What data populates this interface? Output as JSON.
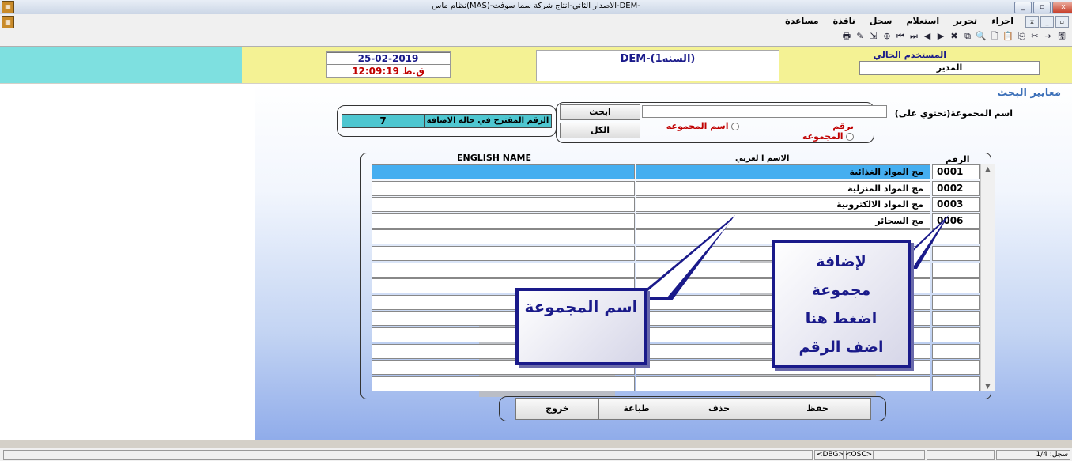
{
  "window": {
    "title": "نظام ماس(MAS)-الاصدار الثاني-انتاج شركة سما سوفت-DEM-",
    "controls": [
      "_",
      "▫",
      "x"
    ]
  },
  "menubar": {
    "items": [
      "اجراء",
      "تحرير",
      "استعلام",
      "سجل",
      "نافذة",
      "مساعدة"
    ],
    "mdi_controls": [
      "x",
      "_",
      "▫"
    ]
  },
  "toolbar": {
    "icons": [
      "save-icon",
      "exit-icon",
      "cut-icon",
      "copy-icon",
      "paste-icon",
      "new-icon",
      "query-icon",
      "duplicate-icon",
      "delete-icon",
      "next-icon",
      "prev-icon",
      "last-icon",
      "first-icon",
      "insert-icon",
      "export-icon",
      "find-icon",
      "print-icon"
    ],
    "glyphs": [
      "🖫",
      "⇥",
      "✂",
      "⎘",
      "📋",
      "🗋",
      "🔍",
      "⧉",
      "✖",
      "▶",
      "◀",
      "⏭",
      "⏮",
      "⊕",
      "⇲",
      "✎",
      "🖶"
    ]
  },
  "header": {
    "date": "25-02-2019",
    "time": "12:09:19 ق.ظ",
    "company": "DEM-(السنه1)",
    "current_user_label": "المستخدم الحالي",
    "current_user": "المدير"
  },
  "search": {
    "page_title": "معايير البحث",
    "group_name_label": "اسم المجموعة(تحتوي على)",
    "group_name_value": "",
    "search_button": "ابحث",
    "all_button": "الكل",
    "radio_by_number": "برقم المجموعه",
    "radio_by_name": "اسم المجموعه",
    "suggested_label": "الرقم المقترح في حالة الاضافة",
    "suggested_value": "7"
  },
  "grid": {
    "columns": {
      "number": "الرقم",
      "arabic": "الاسم ا لعربي",
      "english": "ENGLISH NAME"
    },
    "rows": [
      {
        "number": "0001",
        "arabic": "مج المواد الغذائية",
        "english": "",
        "selected": true
      },
      {
        "number": "0002",
        "arabic": "مج المواد المنزلية",
        "english": "",
        "selected": false
      },
      {
        "number": "0003",
        "arabic": "مج المواد الالكترونية",
        "english": "",
        "selected": false
      },
      {
        "number": "0006",
        "arabic": "مج السجائر",
        "english": "",
        "selected": false
      },
      {
        "number": "",
        "arabic": "",
        "english": "",
        "selected": false
      },
      {
        "number": "",
        "arabic": "",
        "english": "",
        "selected": false
      },
      {
        "number": "",
        "arabic": "",
        "english": "",
        "selected": false
      },
      {
        "number": "",
        "arabic": "",
        "english": "",
        "selected": false
      },
      {
        "number": "",
        "arabic": "",
        "english": "",
        "selected": false
      },
      {
        "number": "",
        "arabic": "",
        "english": "",
        "selected": false
      },
      {
        "number": "",
        "arabic": "",
        "english": "",
        "selected": false
      },
      {
        "number": "",
        "arabic": "",
        "english": "",
        "selected": false
      },
      {
        "number": "",
        "arabic": "",
        "english": "",
        "selected": false
      },
      {
        "number": "",
        "arabic": "",
        "english": "",
        "selected": false
      }
    ]
  },
  "callouts": {
    "group_name": "اسم المجموعة",
    "add_group": [
      "لإضافة",
      "مجموعة",
      "اضغط هنا",
      "اضف الرقم"
    ]
  },
  "actions": {
    "save": "حفظ",
    "delete": "حذف",
    "print": "طباعة",
    "exit": "خروج"
  },
  "statusbar": {
    "dbg": "<DBG>",
    "osc": "<OSC>",
    "record": "سجل: 1/4"
  },
  "colors": {
    "selected_row": "#45aef0",
    "header_left": "#7ee0e0",
    "header_right": "#f4f294",
    "callout_border": "#1a1a8a"
  }
}
